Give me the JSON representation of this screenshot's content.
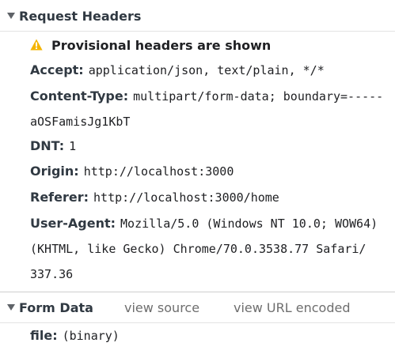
{
  "request_headers": {
    "title": "Request Headers",
    "warning": "Provisional headers are shown",
    "headers": [
      {
        "key": "Accept:",
        "value": "application/json, text/plain, */*"
      },
      {
        "key": "Content-Type:",
        "value": "multipart/form-data; boundary=-----",
        "continuation": "aOSFamisJg1KbT"
      },
      {
        "key": "DNT:",
        "value": "1"
      },
      {
        "key": "Origin:",
        "value": "http://localhost:3000"
      },
      {
        "key": "Referer:",
        "value": "http://localhost:3000/home"
      },
      {
        "key": "User-Agent:",
        "value": "Mozilla/5.0 (Windows NT 10.0; WOW64)",
        "continuation": "(KHTML, like Gecko) Chrome/70.0.3538.77 Safari/",
        "continuation2": "337.36"
      }
    ]
  },
  "form_data": {
    "title": "Form Data",
    "view_source": "view source",
    "view_url_encoded": "view URL encoded",
    "fields": [
      {
        "key": "file:",
        "value": "(binary)"
      }
    ]
  },
  "colors": {
    "warning_yellow": "#f4b400",
    "link_gray": "#6e6e6e",
    "text": "#303942"
  },
  "icons": {
    "collapse_toggle": "triangle-down-icon",
    "warning": "warning-triangle-icon"
  }
}
